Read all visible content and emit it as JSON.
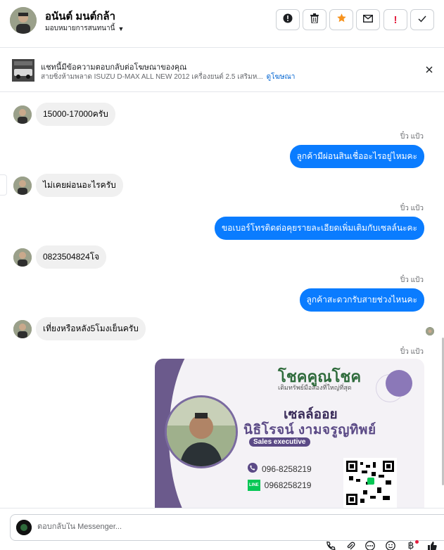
{
  "header": {
    "contact_name": "อนันต์ มนต์กล้า",
    "assign_label": "มอบหมายการสนทนานี้",
    "actions": [
      {
        "name": "report-spam-icon",
        "label": "!"
      },
      {
        "name": "trash-icon"
      },
      {
        "name": "star-icon",
        "color": "#f7931e"
      },
      {
        "name": "mail-icon"
      },
      {
        "name": "follow-up-icon",
        "label": "!",
        "color": "#e41e3f"
      },
      {
        "name": "check-icon"
      }
    ]
  },
  "ad_banner": {
    "title": "แชทนี้มีข้อความตอบกลับต่อโฆษณาของคุณ",
    "subtitle": "สายซิ่งห้ามพลาด ISUZU D-MAX ALL NEW 2012 เครื่องยนต์ 2.5 เสริมห...",
    "link": "ดูโฆษณา"
  },
  "messages": [
    {
      "dir": "in",
      "text": "15000-17000ครับ"
    },
    {
      "dir": "out",
      "sender": "ปิ๋ว แป้ว",
      "text": "ลูกค้ามีผ่อนสินเชื่ออะไรอยู่ไหมคะ"
    },
    {
      "dir": "in",
      "text": "ไม่เคยผ่อนอะไรครับ"
    },
    {
      "dir": "out",
      "sender": "ปิ๋ว แป้ว",
      "text": "ขอเบอร์โทรติดต่อคุยรายละเอียดเพิ่มเติมกับเซลล์นะคะ"
    },
    {
      "dir": "in",
      "text": "0823504824โจ"
    },
    {
      "dir": "out",
      "sender": "ปิ๋ว แป้ว",
      "text": "ลูกค้าสะดวกรับสายช่วงไหนคะ"
    },
    {
      "dir": "in",
      "text": "เที่ยงหรือหลัง5โมงเย็นครับ"
    },
    {
      "dir": "out",
      "sender": "ปิ๋ว แป้ว",
      "type": "image"
    }
  ],
  "business_card": {
    "brand": "โชคคูณโชค",
    "slogan": "เติมทรัพย์มือสองที่ใหญ่ที่สุด",
    "nickname": "เซลล์ออย",
    "full_name": "นิธิโรจน์ งามจรูญทิพย์",
    "role": "Sales executive",
    "phone": "096-8258219",
    "line_badge": "LINE",
    "line_id": "0968258219"
  },
  "composer": {
    "placeholder": "ตอบกลับใน Messenger...",
    "tools": [
      "call-icon",
      "attachment-icon",
      "more-icon",
      "emoji-icon",
      "payment-icon",
      "like-icon"
    ]
  }
}
